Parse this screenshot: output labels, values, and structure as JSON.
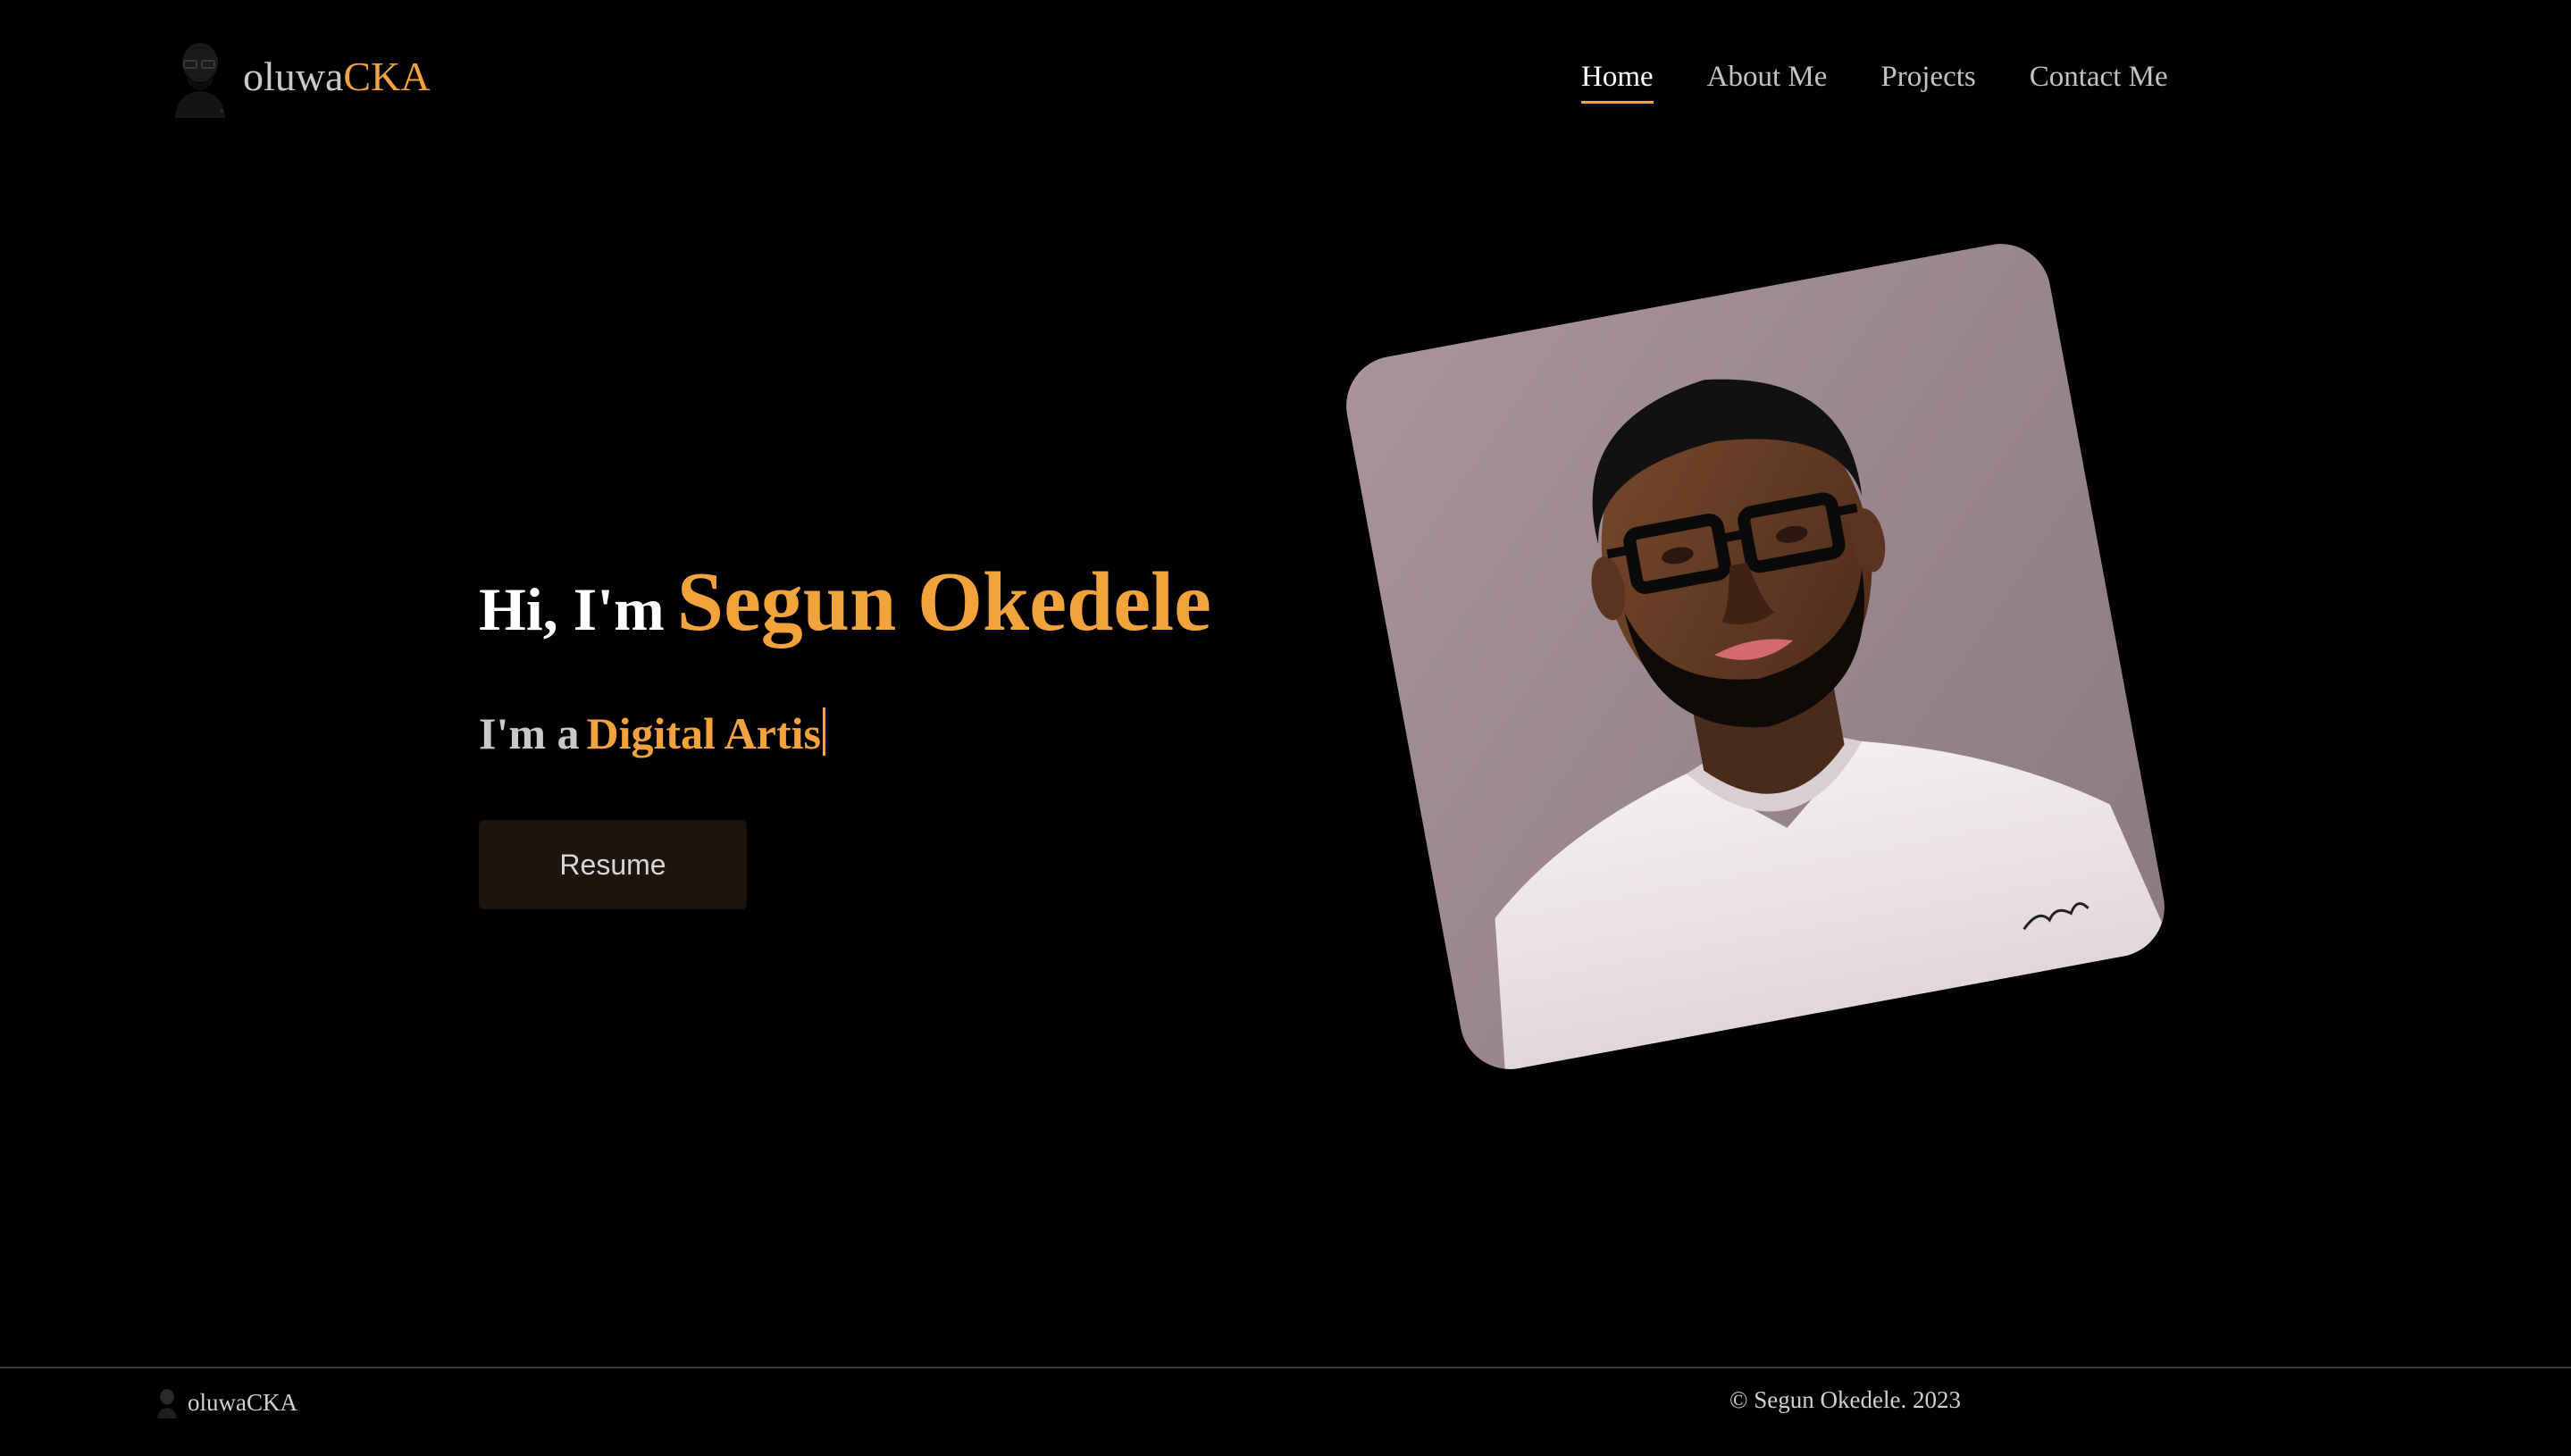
{
  "brand": {
    "prefix": "oluwa",
    "accent": "CKA",
    "footer_name": "oluwaCKA"
  },
  "nav": {
    "items": [
      "Home",
      "About Me",
      "Projects",
      "Contact Me"
    ],
    "active": "Home"
  },
  "hero": {
    "greeting": "Hi, I'm",
    "name": "Segun Okedele",
    "role_prefix": "I'm a",
    "role_typed": "Digital Artis",
    "resume_label": "Resume"
  },
  "footer": {
    "copyright": "© Segun Okedele. 2023"
  },
  "colors": {
    "accent": "#f3a33c",
    "background": "#000000",
    "button_bg": "#1d140d"
  },
  "icons": {
    "logo": "avatar-logo-icon"
  }
}
